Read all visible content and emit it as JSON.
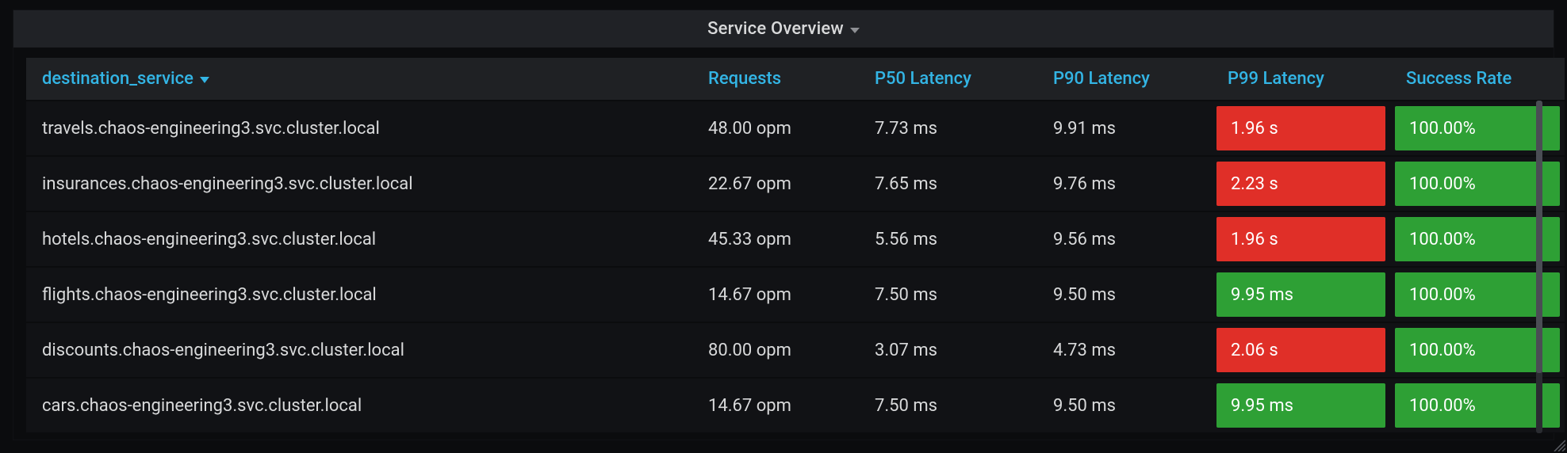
{
  "panel": {
    "title": "Service Overview"
  },
  "columns": {
    "service": "destination_service",
    "requests": "Requests",
    "p50": "P50 Latency",
    "p90": "P90 Latency",
    "p99": "P99 Latency",
    "success": "Success Rate"
  },
  "rows": [
    {
      "service": "travels.chaos-engineering3.svc.cluster.local",
      "requests": "48.00 opm",
      "p50": "7.73 ms",
      "p90": "9.91 ms",
      "p99": {
        "value": "1.96 s",
        "status": "red"
      },
      "success": {
        "value": "100.00%",
        "status": "green"
      }
    },
    {
      "service": "insurances.chaos-engineering3.svc.cluster.local",
      "requests": "22.67 opm",
      "p50": "7.65 ms",
      "p90": "9.76 ms",
      "p99": {
        "value": "2.23 s",
        "status": "red"
      },
      "success": {
        "value": "100.00%",
        "status": "green"
      }
    },
    {
      "service": "hotels.chaos-engineering3.svc.cluster.local",
      "requests": "45.33 opm",
      "p50": "5.56 ms",
      "p90": "9.56 ms",
      "p99": {
        "value": "1.96 s",
        "status": "red"
      },
      "success": {
        "value": "100.00%",
        "status": "green"
      }
    },
    {
      "service": "flights.chaos-engineering3.svc.cluster.local",
      "requests": "14.67 opm",
      "p50": "7.50 ms",
      "p90": "9.50 ms",
      "p99": {
        "value": "9.95 ms",
        "status": "green"
      },
      "success": {
        "value": "100.00%",
        "status": "green"
      }
    },
    {
      "service": "discounts.chaos-engineering3.svc.cluster.local",
      "requests": "80.00 opm",
      "p50": "3.07 ms",
      "p90": "4.73 ms",
      "p99": {
        "value": "2.06 s",
        "status": "red"
      },
      "success": {
        "value": "100.00%",
        "status": "green"
      }
    },
    {
      "service": "cars.chaos-engineering3.svc.cluster.local",
      "requests": "14.67 opm",
      "p50": "7.50 ms",
      "p90": "9.50 ms",
      "p99": {
        "value": "9.95 ms",
        "status": "green"
      },
      "success": {
        "value": "100.00%",
        "status": "green"
      }
    }
  ],
  "colors": {
    "red": "#e02f28",
    "green": "#2ea035",
    "link": "#33b5e5"
  }
}
